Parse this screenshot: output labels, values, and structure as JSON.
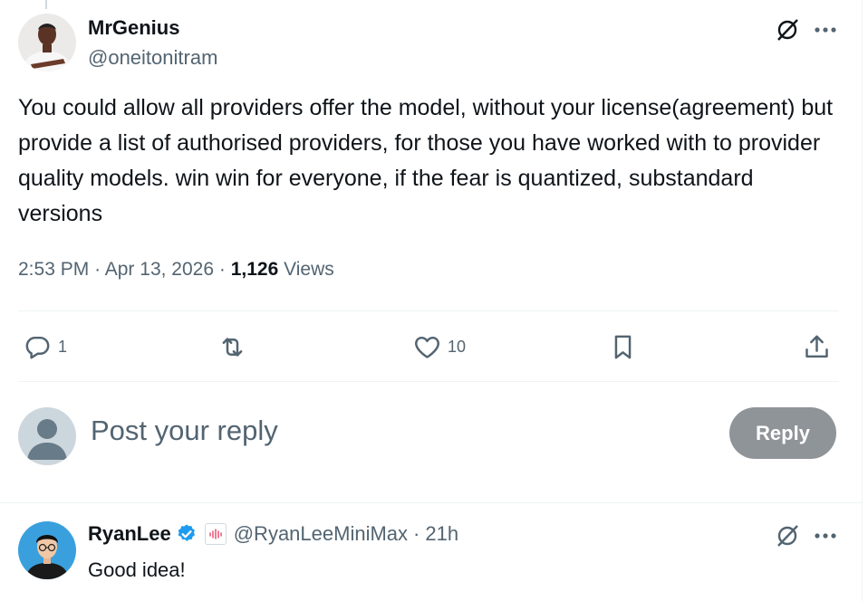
{
  "main_tweet": {
    "author_name": "MrGenius",
    "author_handle": "@oneitonitram",
    "text": "You could allow all providers offer the model, without your license(agreement) but provide a list of authorised providers, for those you have worked with to provider quality models. win win for everyone, if the fear is quantized, substandard versions",
    "time": "2:53 PM",
    "date": "Apr 13, 2026",
    "separator": "·",
    "views_count": "1,126",
    "views_label": "Views",
    "actions": {
      "reply_count": "1",
      "retweet_count": "",
      "like_count": "10"
    },
    "icons": {
      "grok": "grok-icon",
      "more": "more-icon",
      "reply": "reply-icon",
      "retweet": "retweet-icon",
      "like": "heart-icon",
      "bookmark": "bookmark-icon",
      "share": "share-icon"
    }
  },
  "composer": {
    "placeholder": "Post your reply",
    "button_label": "Reply"
  },
  "reply_tweet": {
    "author_name": "RyanLee",
    "author_handle": "@RyanLeeMiniMax",
    "separator": "·",
    "time_ago": "21h",
    "text": "Good idea!",
    "verified_icon": "verified-badge-icon",
    "affiliation_icon": "minimax-affiliation-icon"
  },
  "colors": {
    "text": "#0f1419",
    "secondary": "#536471",
    "verified": "#1d9bf0",
    "reply_button_disabled": "#8f9499"
  }
}
